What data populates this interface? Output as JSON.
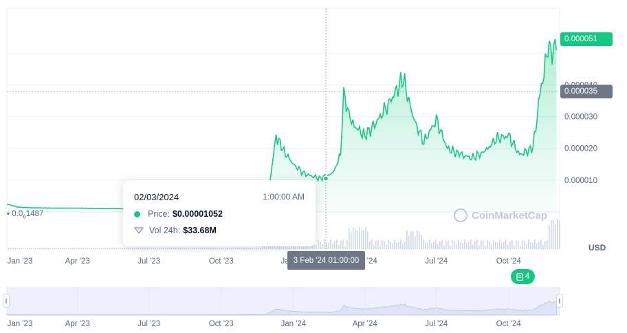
{
  "chart_data": {
    "type": "area",
    "x_labels": [
      "Jan '23",
      "Apr '23",
      "Jul '23",
      "Oct '23",
      "Jan '24",
      "Apr '24",
      "Jul '24",
      "Oct '24"
    ],
    "y_ticks": [
      "0.000010",
      "0.000020",
      "0.000030",
      "0.000040"
    ],
    "ylim": [
      0,
      6.2e-05
    ],
    "currency_label": "USD",
    "series": [
      {
        "x": [
          "2023-01",
          "2023-01-15",
          "2023-02",
          "2023-03",
          "2023-04",
          "2023-05",
          "2023-06",
          "2023-07",
          "2023-08",
          "2023-09",
          "2023-10",
          "2023-11",
          "2023-11-25",
          "2023-12-01",
          "2023-12-10",
          "2023-12-20",
          "2024-01",
          "2024-01-15",
          "2024-02-03",
          "2024-02-20",
          "2024-03-01",
          "2024-03-05",
          "2024-03-15",
          "2024-04",
          "2024-04-15",
          "2024-05",
          "2024-05-20",
          "2024-06-01",
          "2024-06-15",
          "2024-07",
          "2024-07-15",
          "2024-08",
          "2024-08-15",
          "2024-09",
          "2024-09-15",
          "2024-10",
          "2024-10-15",
          "2024-11",
          "2024-11-10",
          "2024-11-20",
          "2024-12-01"
        ],
        "values": [
          2.5e-06,
          1.5e-06,
          1.3e-06,
          1.2e-06,
          1.2e-06,
          1.1e-06,
          1e-06,
          1.1e-06,
          1.2e-06,
          1.4e-06,
          1.6e-06,
          1.8e-06,
          3e-06,
          8e-06,
          2.4e-05,
          1.9e-05,
          1.5e-05,
          1.2e-05,
          1.052e-05,
          1.2e-05,
          1.8e-05,
          3.7e-05,
          2.8e-05,
          2.4e-05,
          2.8e-05,
          3.4e-05,
          4.2e-05,
          3e-05,
          2.2e-05,
          2.9e-05,
          2e-05,
          1.8e-05,
          1.7e-05,
          1.9e-05,
          2.3e-05,
          2.4e-05,
          1.8e-05,
          2e-05,
          3.7e-05,
          5.1e-05,
          5.1e-05
        ],
        "color": "#16c784"
      }
    ],
    "volume_color": "#cfd6e4",
    "current_price_label": "0.000051",
    "crosshair_price_label": "0.000035",
    "crosshair_date_label": "3 Feb '24 01:00:00",
    "start_value_prefix": "0.0",
    "start_value_sub": "6",
    "start_value_suffix": "1487"
  },
  "tooltip": {
    "date": "02/03/2024",
    "time": "1:00:00 AM",
    "price_label": "Price:",
    "price_value": "$0.00001052",
    "vol_label": "Vol 24h:",
    "vol_value": "$33.68M"
  },
  "watermark": "CoinMarketCap",
  "news_count": "4",
  "navigator_labels": [
    "Jan '23",
    "Apr '23",
    "Jul '23",
    "Oct '23",
    "Jan '24",
    "Apr '24",
    "Jul '24",
    "Oct '24"
  ]
}
